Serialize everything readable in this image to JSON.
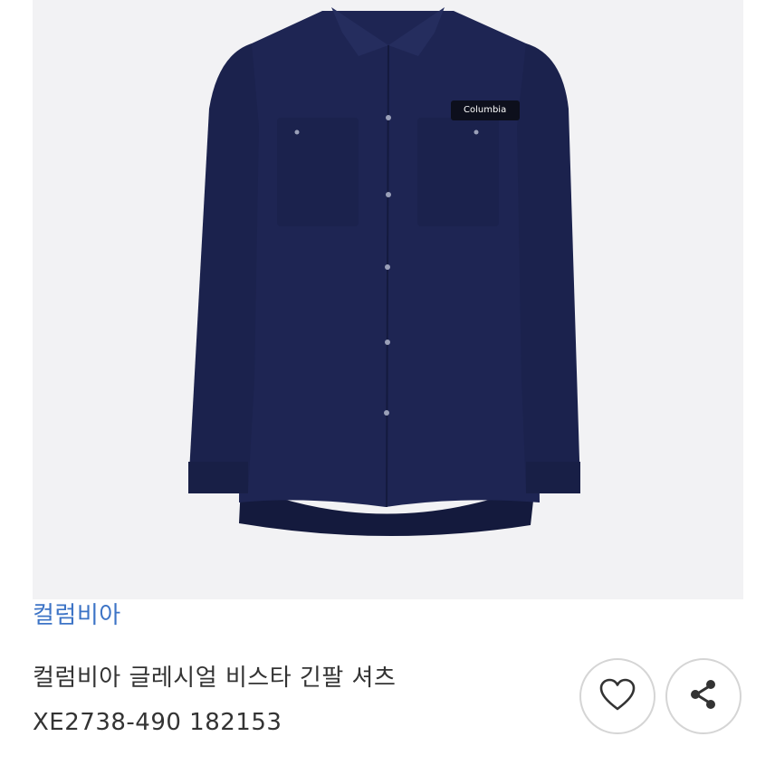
{
  "product": {
    "image_alt": "navy long sleeve shirt",
    "logo_text": "Columbia",
    "brand": "컬럼비아",
    "name": "컬럼비아 글레시얼 비스타 긴팔 셔츠",
    "code": "XE2738-490 182153"
  },
  "actions": {
    "like_icon": "heart-icon",
    "share_icon": "share-icon"
  },
  "colors": {
    "shirt": "#1c2350",
    "background": "#f2f2f4",
    "brand_link": "#3d74c6"
  }
}
